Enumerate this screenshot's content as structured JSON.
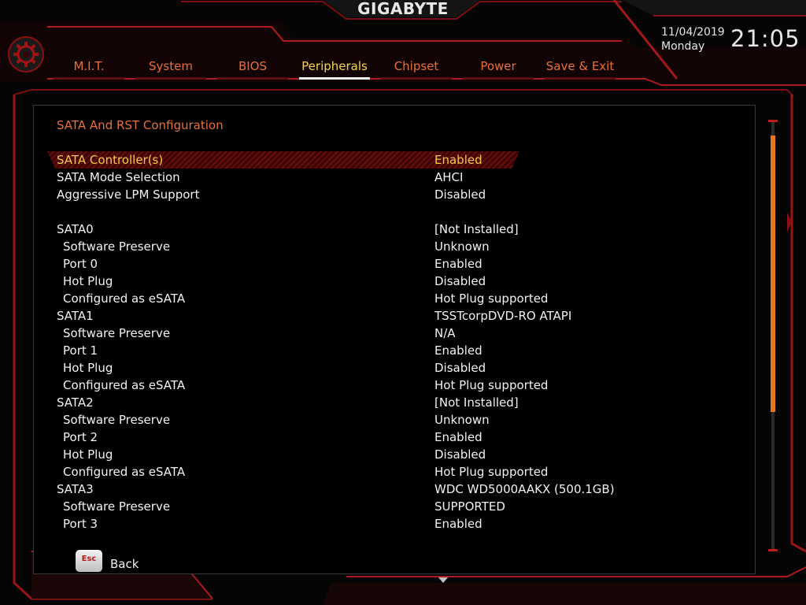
{
  "header": {
    "brand": "GIGABYTE",
    "date": "11/04/2019",
    "day": "Monday",
    "time": "21:05"
  },
  "tabs": [
    {
      "label": "M.I.T.",
      "active": false
    },
    {
      "label": "System",
      "active": false
    },
    {
      "label": "BIOS",
      "active": false
    },
    {
      "label": "Peripherals",
      "active": true
    },
    {
      "label": "Chipset",
      "active": false
    },
    {
      "label": "Power",
      "active": false
    },
    {
      "label": "Save & Exit",
      "active": false
    }
  ],
  "section_title": "SATA And RST Configuration",
  "settings": [
    {
      "label": "SATA Controller(s)",
      "value": "Enabled",
      "selected": true
    },
    {
      "label": "SATA Mode Selection",
      "value": "AHCI"
    },
    {
      "label": "Aggressive LPM Support",
      "value": "Disabled"
    },
    {
      "label": "SATA0",
      "value": "[Not Installed]"
    },
    {
      "label": "Software Preserve",
      "value": "Unknown",
      "sub": true
    },
    {
      "label": "Port 0",
      "value": "Enabled",
      "sub": true
    },
    {
      "label": "Hot Plug",
      "value": "Disabled",
      "sub": true
    },
    {
      "label": "Configured as eSATA",
      "value": "Hot Plug supported",
      "sub": true
    },
    {
      "label": "SATA1",
      "value": "TSSTcorpDVD-RO ATAPI"
    },
    {
      "label": "Software Preserve",
      "value": " N/A",
      "sub": true
    },
    {
      "label": "Port 1",
      "value": "Enabled",
      "sub": true
    },
    {
      "label": "Hot Plug",
      "value": "Disabled",
      "sub": true
    },
    {
      "label": "Configured as eSATA",
      "value": "Hot Plug supported",
      "sub": true
    },
    {
      "label": "SATA2",
      "value": "[Not Installed]"
    },
    {
      "label": "Software Preserve",
      "value": "Unknown",
      "sub": true
    },
    {
      "label": "Port 2",
      "value": "Enabled",
      "sub": true
    },
    {
      "label": "Hot Plug",
      "value": "Disabled",
      "sub": true
    },
    {
      "label": "Configured as eSATA",
      "value": "Hot Plug supported",
      "sub": true
    },
    {
      "label": "SATA3",
      "value": "WDC WD5000AAKX (500.1GB)"
    },
    {
      "label": "Software Preserve",
      "value": "SUPPORTED",
      "sub": true
    },
    {
      "label": "Port 3",
      "value": "Enabled",
      "sub": true
    }
  ],
  "footer": {
    "esc_key": "Esc",
    "back_label": "Back"
  },
  "scroll": {
    "thumb_fraction": 0.64
  },
  "colors": {
    "accent_orange": "#e8703a",
    "active_tab": "#f6d44a",
    "frame_red": "#c21c1c",
    "scroll_thumb": "#e8761e"
  },
  "icons": {
    "settings": "gear-icon",
    "back": "esc-key-icon"
  }
}
